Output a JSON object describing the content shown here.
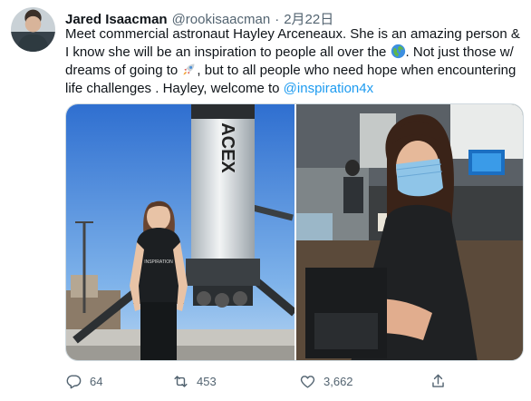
{
  "tweet": {
    "author": {
      "name": "Jared Isaacman",
      "handle": "@rookisaacman",
      "separator": "·",
      "date": "2月22日"
    },
    "text": {
      "part1": "Meet commercial astronaut Hayley Arceneaux. She is an amazing person & I know she will be an inspiration to people all over the ",
      "emoji1": "globe-emoji",
      "part2": ". Not just those w/ dreams of going to ",
      "emoji2": "rocket-emoji",
      "part3": ", but to all people who need hope when encountering life challenges . Hayley, welcome to ",
      "mention": "@inspiration4x"
    },
    "media": {
      "left_photo": {
        "description_text": "ACEX",
        "shirt_text": "INSPIRATION"
      },
      "right_photo": {}
    },
    "actions": {
      "reply": {
        "icon": "reply-icon",
        "count": "64"
      },
      "retweet": {
        "icon": "retweet-icon",
        "count": "453"
      },
      "like": {
        "icon": "heart-icon",
        "count": "3,662"
      },
      "share": {
        "icon": "share-icon"
      }
    },
    "colors": {
      "text": "#0f1419",
      "secondary": "#536471",
      "link": "#1d9bf0"
    }
  }
}
